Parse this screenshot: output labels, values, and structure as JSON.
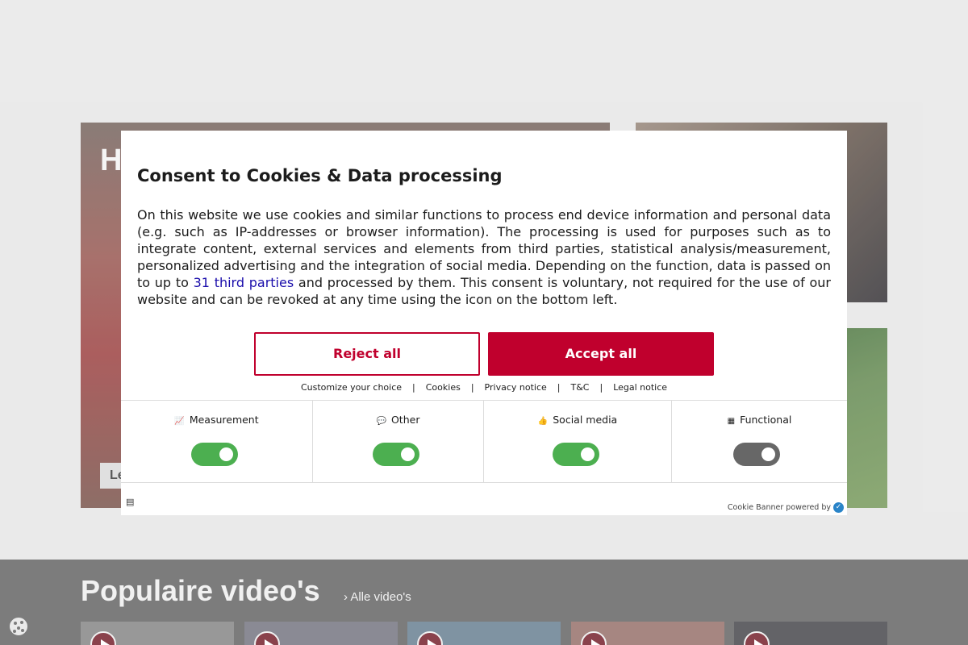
{
  "background": {
    "hero_title": "H",
    "hero_more": "Le",
    "popular_title": "Populaire video's",
    "popular_all": "Alle video's"
  },
  "dialog": {
    "title": "Consent to Cookies & Data processing",
    "text_before_link": "On this website we use cookies and similar functions to process end device information and personal data (e.g. such as IP-addresses or browser information). The processing is used for purposes such as to integrate content, external services and elements from third parties, statistical analysis/measurement, personalized advertising and the integration of social media. Depending on the function, data is passed on to up to ",
    "third_parties_link": "31 third parties",
    "text_after_link": " and processed by them. This consent is voluntary, not required for the use of our website and can be revoked at any time using the icon on the bottom left.",
    "reject_label": "Reject all",
    "accept_label": "Accept all",
    "links": {
      "customize": "Customize your choice",
      "cookies": "Cookies",
      "privacy": "Privacy notice",
      "tc": "T&C",
      "legal": "Legal notice"
    },
    "categories": [
      {
        "label": "Measurement",
        "icon": "chart-icon",
        "enabled": true
      },
      {
        "label": "Other",
        "icon": "chat-icon",
        "enabled": true
      },
      {
        "label": "Social media",
        "icon": "thumbs-up-icon",
        "enabled": true
      },
      {
        "label": "Functional",
        "icon": "grid-icon",
        "enabled": false
      }
    ],
    "powered_by": "Cookie Banner powered by"
  },
  "colors": {
    "accent": "#c0002d",
    "toggle_on": "#4caf50",
    "toggle_off": "#676767",
    "link": "#1a0dab"
  }
}
